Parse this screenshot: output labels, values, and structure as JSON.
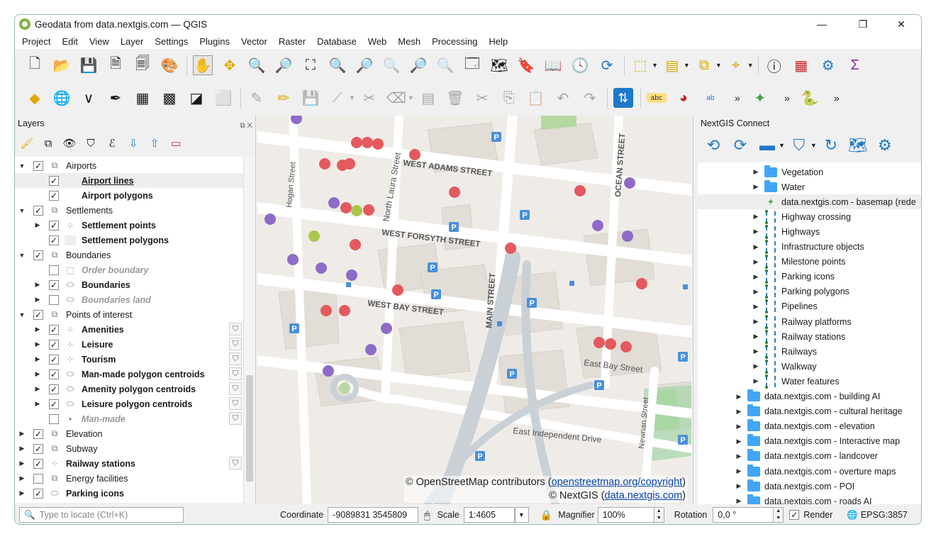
{
  "window": {
    "title": "Geodata from data.nextgis.com — QGIS",
    "controls": [
      "—",
      "❐",
      "✕"
    ]
  },
  "menu": [
    "Project",
    "Edit",
    "View",
    "Layer",
    "Settings",
    "Plugins",
    "Vector",
    "Raster",
    "Database",
    "Web",
    "Mesh",
    "Processing",
    "Help"
  ],
  "toolbar1": [
    "new-project",
    "open-project",
    "save-project",
    "new-print-layout",
    "layout-manager",
    "style-manager",
    "pan-map",
    "pan-to-selection",
    "zoom-in",
    "zoom-out",
    "zoom-full",
    "zoom-to-selection",
    "zoom-to-layer",
    "zoom-native",
    "zoom-last",
    "zoom-next",
    "new-map-view",
    "new-3d-view",
    "new-spatial-bookmark",
    "show-bookmarks",
    "temporal-controller",
    "refresh",
    "select-features",
    "open-attribute-table",
    "deselect",
    "select-by-location",
    "identify",
    "measure",
    "processing-toolbox",
    "statistics"
  ],
  "toolbar2": [
    "data-source-manager",
    "new-geopackage-layer",
    "new-shapefile-layer",
    "new-spatialite-layer",
    "new-temporary-layer",
    "new-virtual-layer",
    "new-mesh-layer",
    "digitize",
    "current-edits",
    "toggle-editing",
    "save-edits",
    "add-line",
    "vertex-tool",
    "delete-selected",
    "cut",
    "copy",
    "paste",
    "undo",
    "redo",
    "ngc-sync",
    "label-tool",
    "diagram-tool",
    "label-options",
    "select-by-radius",
    "python-console"
  ],
  "layers_panel": {
    "title": "Layers",
    "tree": [
      {
        "label": "Airports",
        "level": 0,
        "expand": "▼",
        "checked": true,
        "icon": "group",
        "style": "normal"
      },
      {
        "label": "Airport lines",
        "level": 1,
        "expand": "",
        "checked": true,
        "icon": "none",
        "style": "bold-underline",
        "selected": true
      },
      {
        "label": "Airport polygons",
        "level": 1,
        "expand": "",
        "checked": true,
        "icon": "none",
        "style": "bold"
      },
      {
        "label": "Settlements",
        "level": 0,
        "expand": "▼",
        "checked": true,
        "icon": "group",
        "style": "normal"
      },
      {
        "label": "Settlement points",
        "level": 1,
        "expand": "▶",
        "checked": true,
        "icon": "points",
        "style": "bold"
      },
      {
        "label": "Settlement polygons",
        "level": 1,
        "expand": "",
        "checked": true,
        "icon": "polygon",
        "style": "bold"
      },
      {
        "label": "Boundaries",
        "level": 0,
        "expand": "▼",
        "checked": true,
        "icon": "group",
        "style": "normal"
      },
      {
        "label": "Order boundary",
        "level": 1,
        "expand": "",
        "checked": false,
        "icon": "dash",
        "style": "italic-dim"
      },
      {
        "label": "Boundaries",
        "level": 1,
        "expand": "▶",
        "checked": true,
        "icon": "polygon",
        "style": "bold"
      },
      {
        "label": "Boundaries land",
        "level": 1,
        "expand": "▶",
        "checked": false,
        "icon": "polygon",
        "style": "italic-dim"
      },
      {
        "label": "Points of interest",
        "level": 0,
        "expand": "▼",
        "checked": true,
        "icon": "group",
        "style": "normal"
      },
      {
        "label": "Amenities",
        "level": 1,
        "expand": "▶",
        "checked": true,
        "icon": "points",
        "style": "bold",
        "filter": true
      },
      {
        "label": "Leisure",
        "level": 1,
        "expand": "▶",
        "checked": true,
        "icon": "points",
        "style": "bold",
        "filter": true
      },
      {
        "label": "Tourism",
        "level": 1,
        "expand": "▶",
        "checked": true,
        "icon": "points",
        "style": "bold",
        "filter": true
      },
      {
        "label": "Man-made polygon centroids",
        "level": 1,
        "expand": "▶",
        "checked": true,
        "icon": "polygon",
        "style": "bold",
        "filter": true
      },
      {
        "label": "Amenity polygon centroids",
        "level": 1,
        "expand": "▶",
        "checked": true,
        "icon": "polygon",
        "style": "bold",
        "filter": true
      },
      {
        "label": "Leisure polygon centroids",
        "level": 1,
        "expand": "▶",
        "checked": true,
        "icon": "polygon",
        "style": "bold",
        "filter": true
      },
      {
        "label": "Man-made",
        "level": 1,
        "expand": "",
        "checked": false,
        "icon": "dot",
        "style": "italic-dim",
        "filter": true
      },
      {
        "label": "Elevation",
        "level": 0,
        "expand": "▶",
        "checked": true,
        "icon": "group",
        "style": "normal"
      },
      {
        "label": "Subway",
        "level": 0,
        "expand": "▶",
        "checked": true,
        "icon": "group",
        "style": "normal"
      },
      {
        "label": "Railway stations",
        "level": 0,
        "expand": "▶",
        "checked": true,
        "icon": "points",
        "style": "bold",
        "filter": true
      },
      {
        "label": "Energy facilities",
        "level": 0,
        "expand": "▶",
        "checked": false,
        "icon": "group",
        "style": "normal"
      },
      {
        "label": "Parking icons",
        "level": 0,
        "expand": "▶",
        "checked": true,
        "icon": "polygon",
        "style": "bold"
      }
    ]
  },
  "map": {
    "streets": [
      "WEST ADAMS STREET",
      "WEST FORSYTH STREET",
      "WEST BAY STREET",
      "East Bay Street",
      "East Independent Drive",
      "North Laura Street",
      "Hogan Street",
      "MAIN STREET",
      "OCEAN STREET",
      "Newnan Street"
    ],
    "parking_label": "P",
    "attribution": {
      "line1_prefix": "© OpenStreetMap contributors (",
      "line1_link": "openstreetmap.org/copyright",
      "line1_suffix": ")",
      "line2_prefix": "© NextGIS (",
      "line2_link": "data.nextgis.com",
      "line2_suffix": ")"
    }
  },
  "ngc_panel": {
    "title": "NextGIS Connect",
    "tree": [
      {
        "label": "Vegetation",
        "indent": 2,
        "expand": "▶",
        "icon": "folder"
      },
      {
        "label": "Water",
        "indent": 2,
        "expand": "▶",
        "icon": "folder"
      },
      {
        "label": "data.nextgis.com - basemap (rede",
        "indent": 2,
        "expand": "",
        "icon": "basemap",
        "selected": true
      },
      {
        "label": "Highway crossing",
        "indent": 2,
        "expand": "▶",
        "icon": "layer"
      },
      {
        "label": "Highways",
        "indent": 2,
        "expand": "▶",
        "icon": "layer"
      },
      {
        "label": "Infrastructure objects",
        "indent": 2,
        "expand": "▶",
        "icon": "layer"
      },
      {
        "label": "Milestone points",
        "indent": 2,
        "expand": "▶",
        "icon": "layer"
      },
      {
        "label": "Parking icons",
        "indent": 2,
        "expand": "▶",
        "icon": "layer"
      },
      {
        "label": "Parking polygons",
        "indent": 2,
        "expand": "▶",
        "icon": "layer"
      },
      {
        "label": "Pipelines",
        "indent": 2,
        "expand": "▶",
        "icon": "layer"
      },
      {
        "label": "Railway platforms",
        "indent": 2,
        "expand": "▶",
        "icon": "layer"
      },
      {
        "label": "Railway stations",
        "indent": 2,
        "expand": "▶",
        "icon": "layer"
      },
      {
        "label": "Railways",
        "indent": 2,
        "expand": "▶",
        "icon": "layer"
      },
      {
        "label": "Walkway",
        "indent": 2,
        "expand": "▶",
        "icon": "layer"
      },
      {
        "label": "Water features",
        "indent": 2,
        "expand": "▶",
        "icon": "layer"
      },
      {
        "label": "data.nextgis.com - building AI",
        "indent": 1,
        "expand": "▶",
        "icon": "folder"
      },
      {
        "label": "data.nextgis.com - cultural heritage",
        "indent": 1,
        "expand": "▶",
        "icon": "folder"
      },
      {
        "label": "data.nextgis.com - elevation",
        "indent": 1,
        "expand": "▶",
        "icon": "folder"
      },
      {
        "label": "data.nextgis.com - Interactive map",
        "indent": 1,
        "expand": "▶",
        "icon": "folder"
      },
      {
        "label": "data.nextgis.com - landcover",
        "indent": 1,
        "expand": "▶",
        "icon": "folder"
      },
      {
        "label": "data.nextgis.com - overture maps",
        "indent": 1,
        "expand": "▶",
        "icon": "folder"
      },
      {
        "label": "data.nextgis.com - POI",
        "indent": 1,
        "expand": "▶",
        "icon": "folder"
      },
      {
        "label": "data.nextgis.com - roads AI",
        "indent": 1,
        "expand": "▶",
        "icon": "folder"
      }
    ]
  },
  "status": {
    "locate_placeholder": "Type to locate (Ctrl+K)",
    "coordinate_label": "Coordinate",
    "coordinate_value": "-9089831  3545809",
    "scale_label": "Scale",
    "scale_value": "1:4605",
    "magnifier_label": "Magnifier",
    "magnifier_value": "100%",
    "rotation_label": "Rotation",
    "rotation_value": "0,0 °",
    "render_label": "Render",
    "render_checked": true,
    "crs": "EPSG:3857"
  },
  "colors": {
    "accent": "#1f78c8",
    "poi_red": "#e4595e",
    "poi_purple": "#8e6bc8",
    "parking": "#4a90d9",
    "park_green": "#a5d6a7"
  }
}
